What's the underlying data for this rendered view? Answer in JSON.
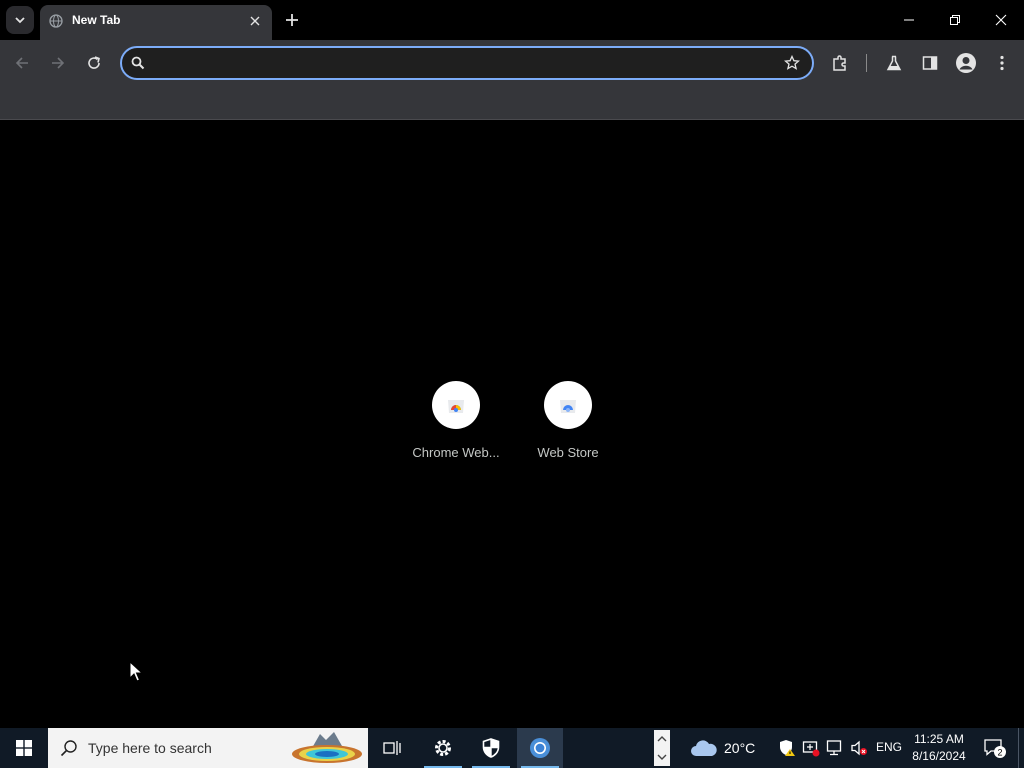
{
  "browser": {
    "tab": {
      "title": "New Tab",
      "favicon": "globe-icon"
    },
    "omnibox": {
      "value": "",
      "placeholder": ""
    },
    "toolbar_icons": [
      "back-icon",
      "forward-icon",
      "reload-icon",
      "star-icon",
      "extensions-icon",
      "labs-flask-icon",
      "side-panel-icon",
      "profile-icon",
      "menu-icon"
    ],
    "accent": "#7cacf8"
  },
  "newtab": {
    "shortcuts": [
      {
        "label": "Chrome Web...",
        "icon": "chrome-web-store-icon"
      },
      {
        "label": "Web Store",
        "icon": "web-store-icon"
      }
    ]
  },
  "taskbar": {
    "search_placeholder": "Type here to search",
    "weather": {
      "temp": "20°C",
      "icon": "cloud-icon"
    },
    "language": "ENG",
    "time": "11:25 AM",
    "date": "8/16/2024",
    "notification_count": "2",
    "apps": [
      "task-view-icon",
      "settings-icon",
      "windows-security-icon",
      "chrome-icon"
    ]
  }
}
